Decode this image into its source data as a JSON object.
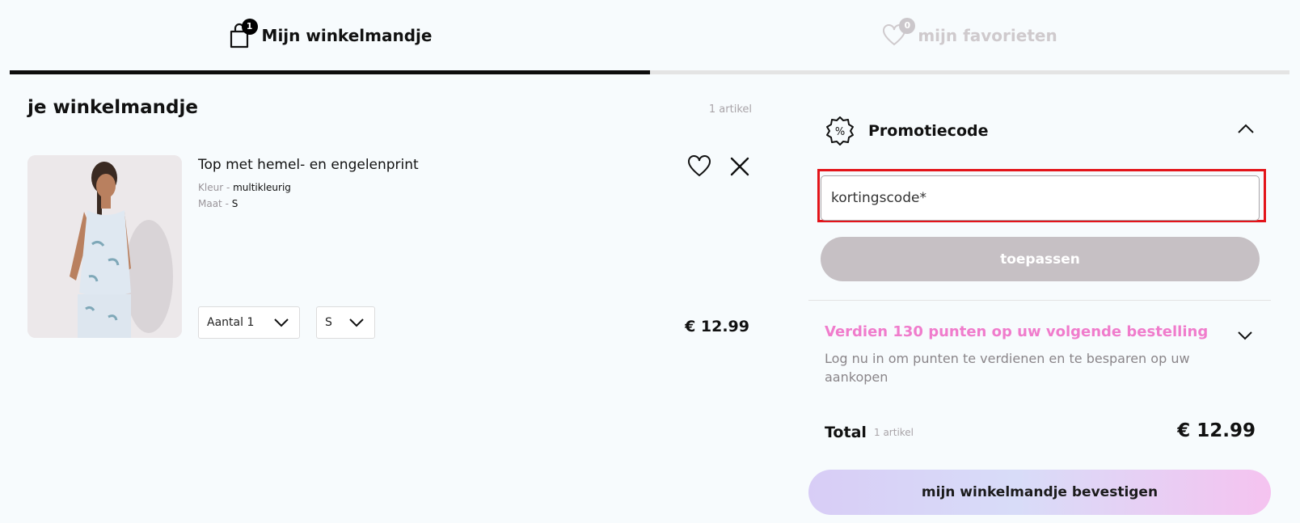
{
  "tabs": {
    "cart": {
      "label": "Mijn winkelmandje",
      "badge": "1",
      "icon": "shopping-bag-icon"
    },
    "favorites": {
      "label": "mijn favorieten",
      "badge": "0",
      "icon": "heart-icon"
    }
  },
  "cart": {
    "title": "je winkelmandje",
    "count": "1 artikel",
    "items": [
      {
        "name": "Top met hemel- en engelenprint",
        "color_label": "Kleur - ",
        "color_value": "multikleurig",
        "size_label": "Maat - ",
        "size_value": "S",
        "quantity_select": "Aantal 1",
        "size_select": "S",
        "price": "€ 12.99"
      }
    ]
  },
  "promo": {
    "title": "Promotiecode",
    "input_placeholder": "kortingscode*",
    "apply_label": "toepassen"
  },
  "loyalty": {
    "title": "Verdien 130 punten op uw volgende bestelling",
    "description": "Log nu in om punten te verdienen en te besparen op uw aankopen"
  },
  "summary": {
    "total_label": "Total",
    "total_count": "1 artikel",
    "total_price": "€ 12.99",
    "confirm_label": "mijn winkelmandje bevestigen"
  },
  "colors": {
    "accent_pink": "#f07ccc",
    "highlight_red": "#e3141a",
    "button_grey": "#c6c0c4"
  }
}
